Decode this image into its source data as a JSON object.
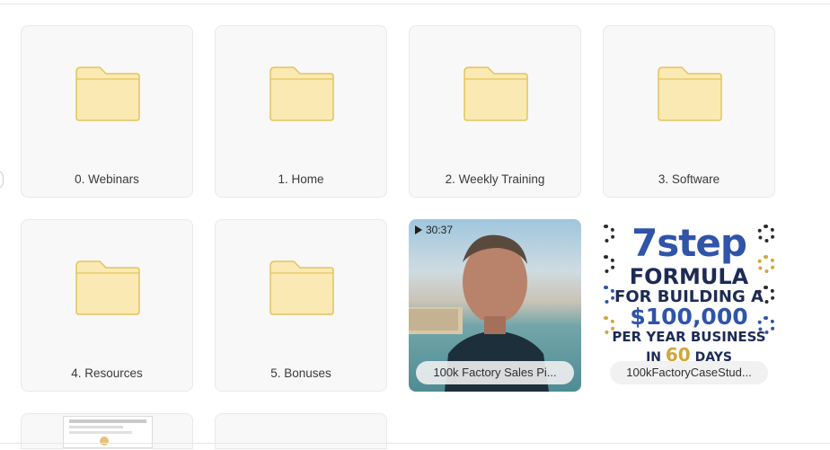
{
  "folders": [
    {
      "name": "0. Webinars"
    },
    {
      "name": "1. Home"
    },
    {
      "name": "2. Weekly Training"
    },
    {
      "name": "3. Software"
    },
    {
      "name": "4. Resources"
    },
    {
      "name": "5. Bonuses"
    }
  ],
  "video": {
    "duration": "30:37",
    "name": "100k Factory Sales Pi..."
  },
  "promo_file": {
    "name": "100kFactoryCaseStud...",
    "line1": "7step",
    "line2": "FORMULA",
    "line3": "FOR BUILDING A",
    "line4": "$100,000",
    "line5": "PER YEAR BUSINESS",
    "line6_pre": "IN",
    "line6_num": "60",
    "line6_post": "DAYS"
  },
  "colors": {
    "folder_fill": "#fbe9b3",
    "folder_stroke": "#e2c45d",
    "tile_bg": "#f8f8f8",
    "promo_blue": "#2f54a8",
    "promo_gold": "#d2a53a"
  },
  "icons": {
    "folder": "folder-icon",
    "play": "play-icon"
  }
}
